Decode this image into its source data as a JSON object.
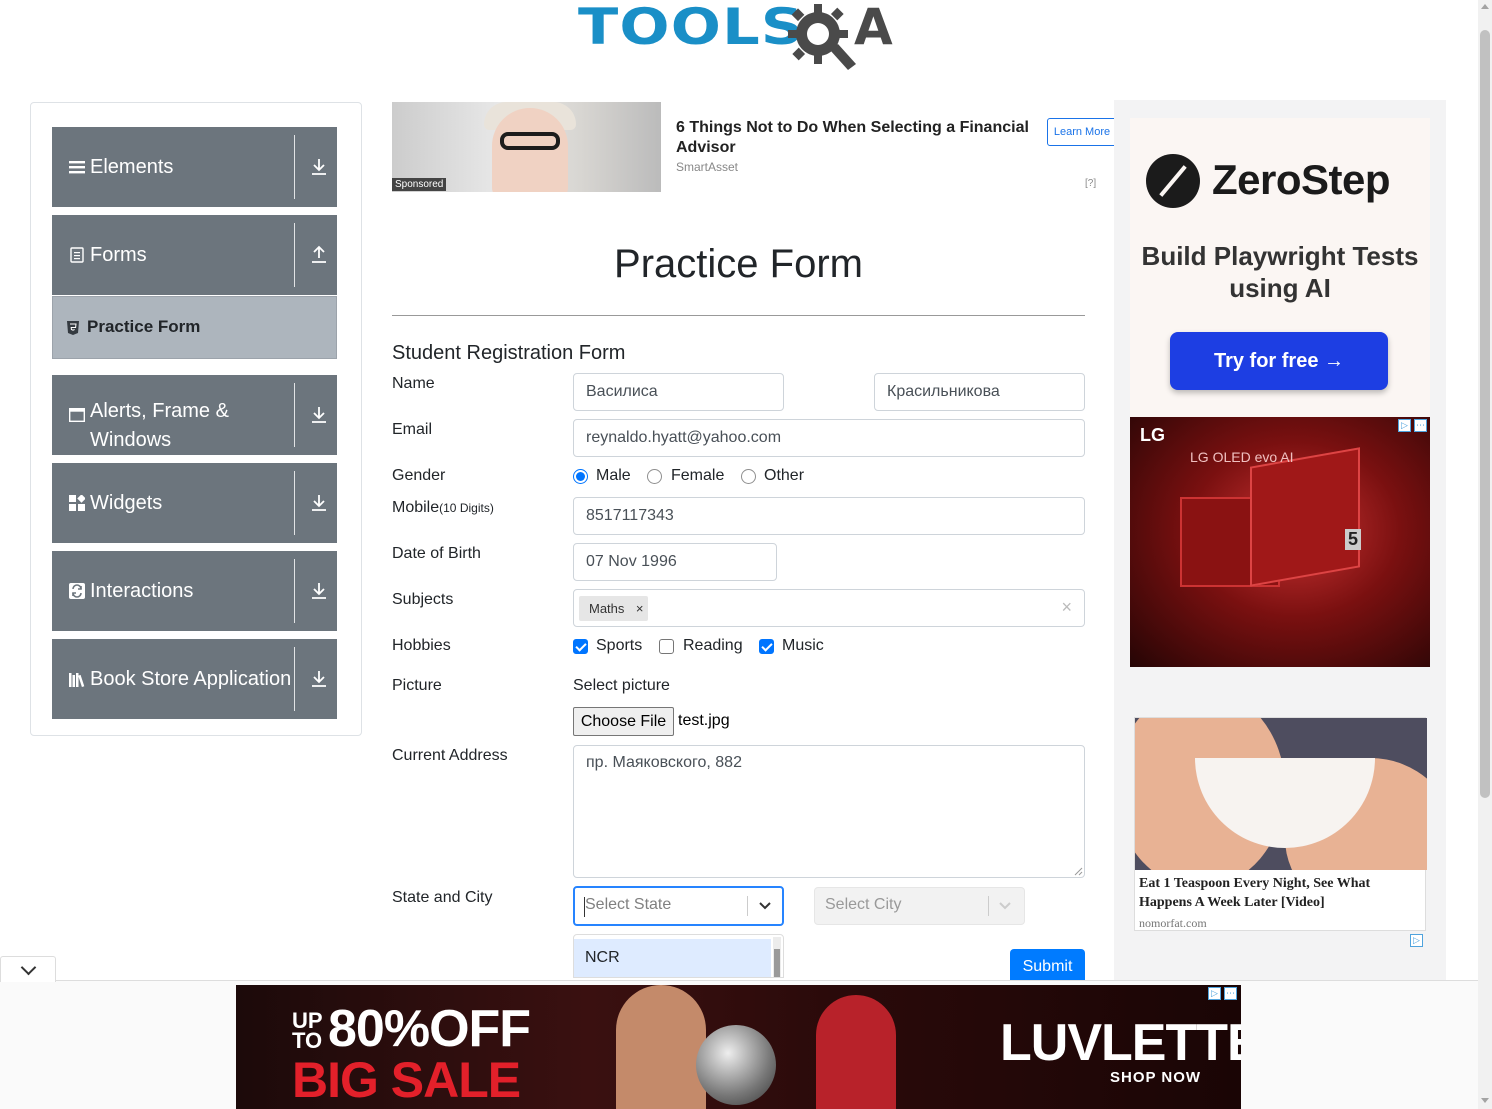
{
  "header": {
    "logo_text": "TOOLS",
    "logo_suffix": "A"
  },
  "sidebar": {
    "groups": [
      {
        "label": "Elements",
        "icon": "hamburger-icon",
        "arrow": "download-icon"
      },
      {
        "label": "Forms",
        "icon": "document-icon",
        "arrow": "upload-icon"
      },
      {
        "label": "Alerts, Frame & Windows",
        "icon": "window-icon",
        "arrow": "download-icon"
      },
      {
        "label": "Widgets",
        "icon": "widgets-icon",
        "arrow": "download-icon"
      },
      {
        "label": "Interactions",
        "icon": "interactions-icon",
        "arrow": "download-icon"
      },
      {
        "label": "Book Store Application",
        "icon": "books-icon",
        "arrow": "download-icon"
      }
    ],
    "active_item": {
      "label": "Practice Form",
      "icon": "html-icon"
    }
  },
  "ad_top": {
    "sponsored": "Sponsored",
    "headline": "6 Things Not to Do When Selecting a Financial Advisor",
    "source": "SmartAsset",
    "cta": "Learn More",
    "adchoice": "[?]"
  },
  "form": {
    "page_title": "Practice Form",
    "heading": "Student Registration Form",
    "name_label": "Name",
    "first_name": "Василиса",
    "last_name": "Красильникова",
    "email_label": "Email",
    "email": "reynaldo.hyatt@yahoo.com",
    "gender_label": "Gender",
    "gender_options": [
      "Male",
      "Female",
      "Other"
    ],
    "gender_selected": "Male",
    "mobile_label": "Mobile",
    "mobile_hint": "(10 Digits)",
    "mobile": "8517117343",
    "dob_label": "Date of Birth",
    "dob": "07 Nov 1996",
    "subjects_label": "Subjects",
    "subjects": [
      "Maths"
    ],
    "chip_remove": "×",
    "clear_all": "×",
    "hobbies_label": "Hobbies",
    "hobbies": [
      {
        "label": "Sports",
        "checked": true
      },
      {
        "label": "Reading",
        "checked": false
      },
      {
        "label": "Music",
        "checked": true
      }
    ],
    "picture_label": "Picture",
    "picture_prompt": "Select picture",
    "file_button": "Choose File",
    "file_name": "test.jpg",
    "address_label": "Current Address",
    "address": "пр. Маяковского, 882",
    "state_city_label": "State and City",
    "state_placeholder": "Select State",
    "city_placeholder": "Select City",
    "state_menu_options": [
      "NCR"
    ],
    "submit": "Submit"
  },
  "ad_right": {
    "zerostep_brand": "ZeroStep",
    "zerostep_sub": "Build Playwright Tests using AI",
    "zerostep_cta": "Try for free →",
    "lg_brand": "LG",
    "lg_tv": "LG OLED evo AI",
    "lg_num": "5",
    "nomo_headline": "Eat 1 Teaspoon Every Night, See What Happens A Week Later [Video]",
    "nomo_source": "nomorfat.com"
  },
  "ad_bottom": {
    "upto": "UP TO",
    "off": "80%OFF",
    "sale": "BIG SALE",
    "brand": "LUVLETTE",
    "shop": "SHOP NOW"
  },
  "colors": {
    "accent": "#007bff",
    "sidebar_group": "#6c757d",
    "sidebar_active": "#adb5bd",
    "logo_blue": "#1a8fc7",
    "focus_border": "#2684ff"
  }
}
